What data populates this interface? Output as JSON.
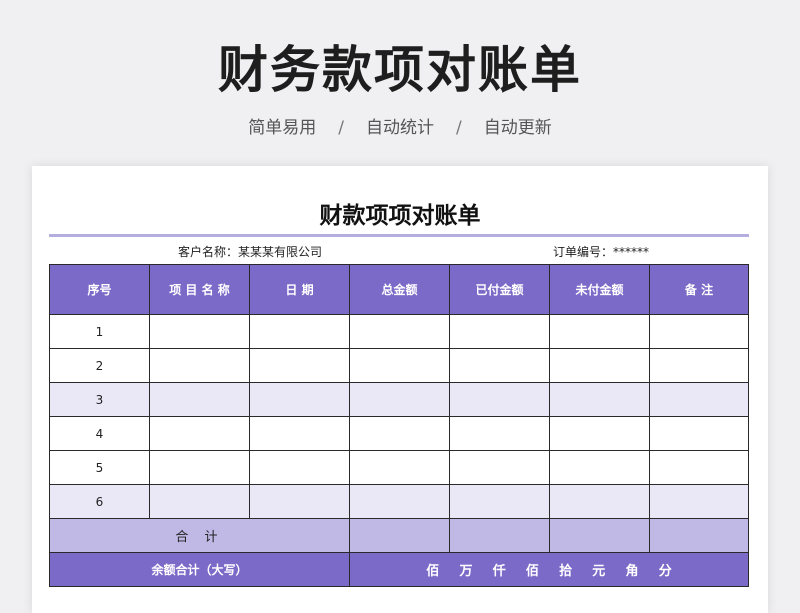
{
  "hero": {
    "title": "财务款项对账单",
    "tags": [
      "简单易用",
      "自动统计",
      "自动更新"
    ],
    "separator": "/"
  },
  "sheet": {
    "title": "财款项项对账单",
    "customer_label": "客户名称：",
    "customer_value": "某某某有限公司",
    "order_label": "订单编号：",
    "order_value": "******"
  },
  "table": {
    "columns": [
      "序号",
      "项 目 名 称",
      "日 期",
      "总金额",
      "已付金额",
      "未付金额",
      "备 注"
    ],
    "rows": [
      "1",
      "2",
      "3",
      "4",
      "5",
      "6"
    ],
    "total_label": "合 计",
    "capital_label": "余额合计（大写）",
    "capital_units": [
      "佰",
      "万",
      "仟",
      "佰",
      "拾",
      "元",
      "角",
      "分"
    ]
  },
  "colors": {
    "header": "#7b6ac8",
    "shaded_row": "#eae7f7",
    "total_row": "#c0b9e6",
    "rule": "#b3aedd"
  }
}
